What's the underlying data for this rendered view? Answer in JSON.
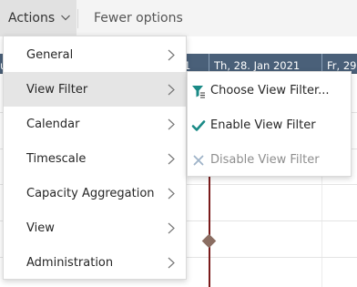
{
  "toolbar": {
    "actions_label": "Actions",
    "fewer_options_label": "Fewer options"
  },
  "gantt": {
    "dates": [
      "u",
      "1",
      "Th, 28. Jan 2021",
      "Fr, 29."
    ]
  },
  "menu": {
    "items": [
      {
        "label": "General",
        "icon": "chevron-right-icon"
      },
      {
        "label": "View Filter",
        "icon": "chevron-right-icon"
      },
      {
        "label": "Calendar",
        "icon": "chevron-right-icon"
      },
      {
        "label": "Timescale",
        "icon": "chevron-right-icon"
      },
      {
        "label": "Capacity Aggregation",
        "icon": "chevron-right-icon"
      },
      {
        "label": "View",
        "icon": "chevron-right-icon"
      },
      {
        "label": "Administration",
        "icon": "chevron-right-icon"
      }
    ]
  },
  "submenu": {
    "items": [
      {
        "label": "Choose View Filter...",
        "icon": "filter-icon"
      },
      {
        "label": "Enable View Filter",
        "icon": "checkmark-icon"
      },
      {
        "label": "Disable View Filter",
        "icon": "close-icon"
      }
    ]
  },
  "colors": {
    "header_bg": "#4a6079",
    "today_line": "#7a1b1b",
    "accent_teal": "#1a8a86",
    "menu_active": "#e5e5e5"
  }
}
